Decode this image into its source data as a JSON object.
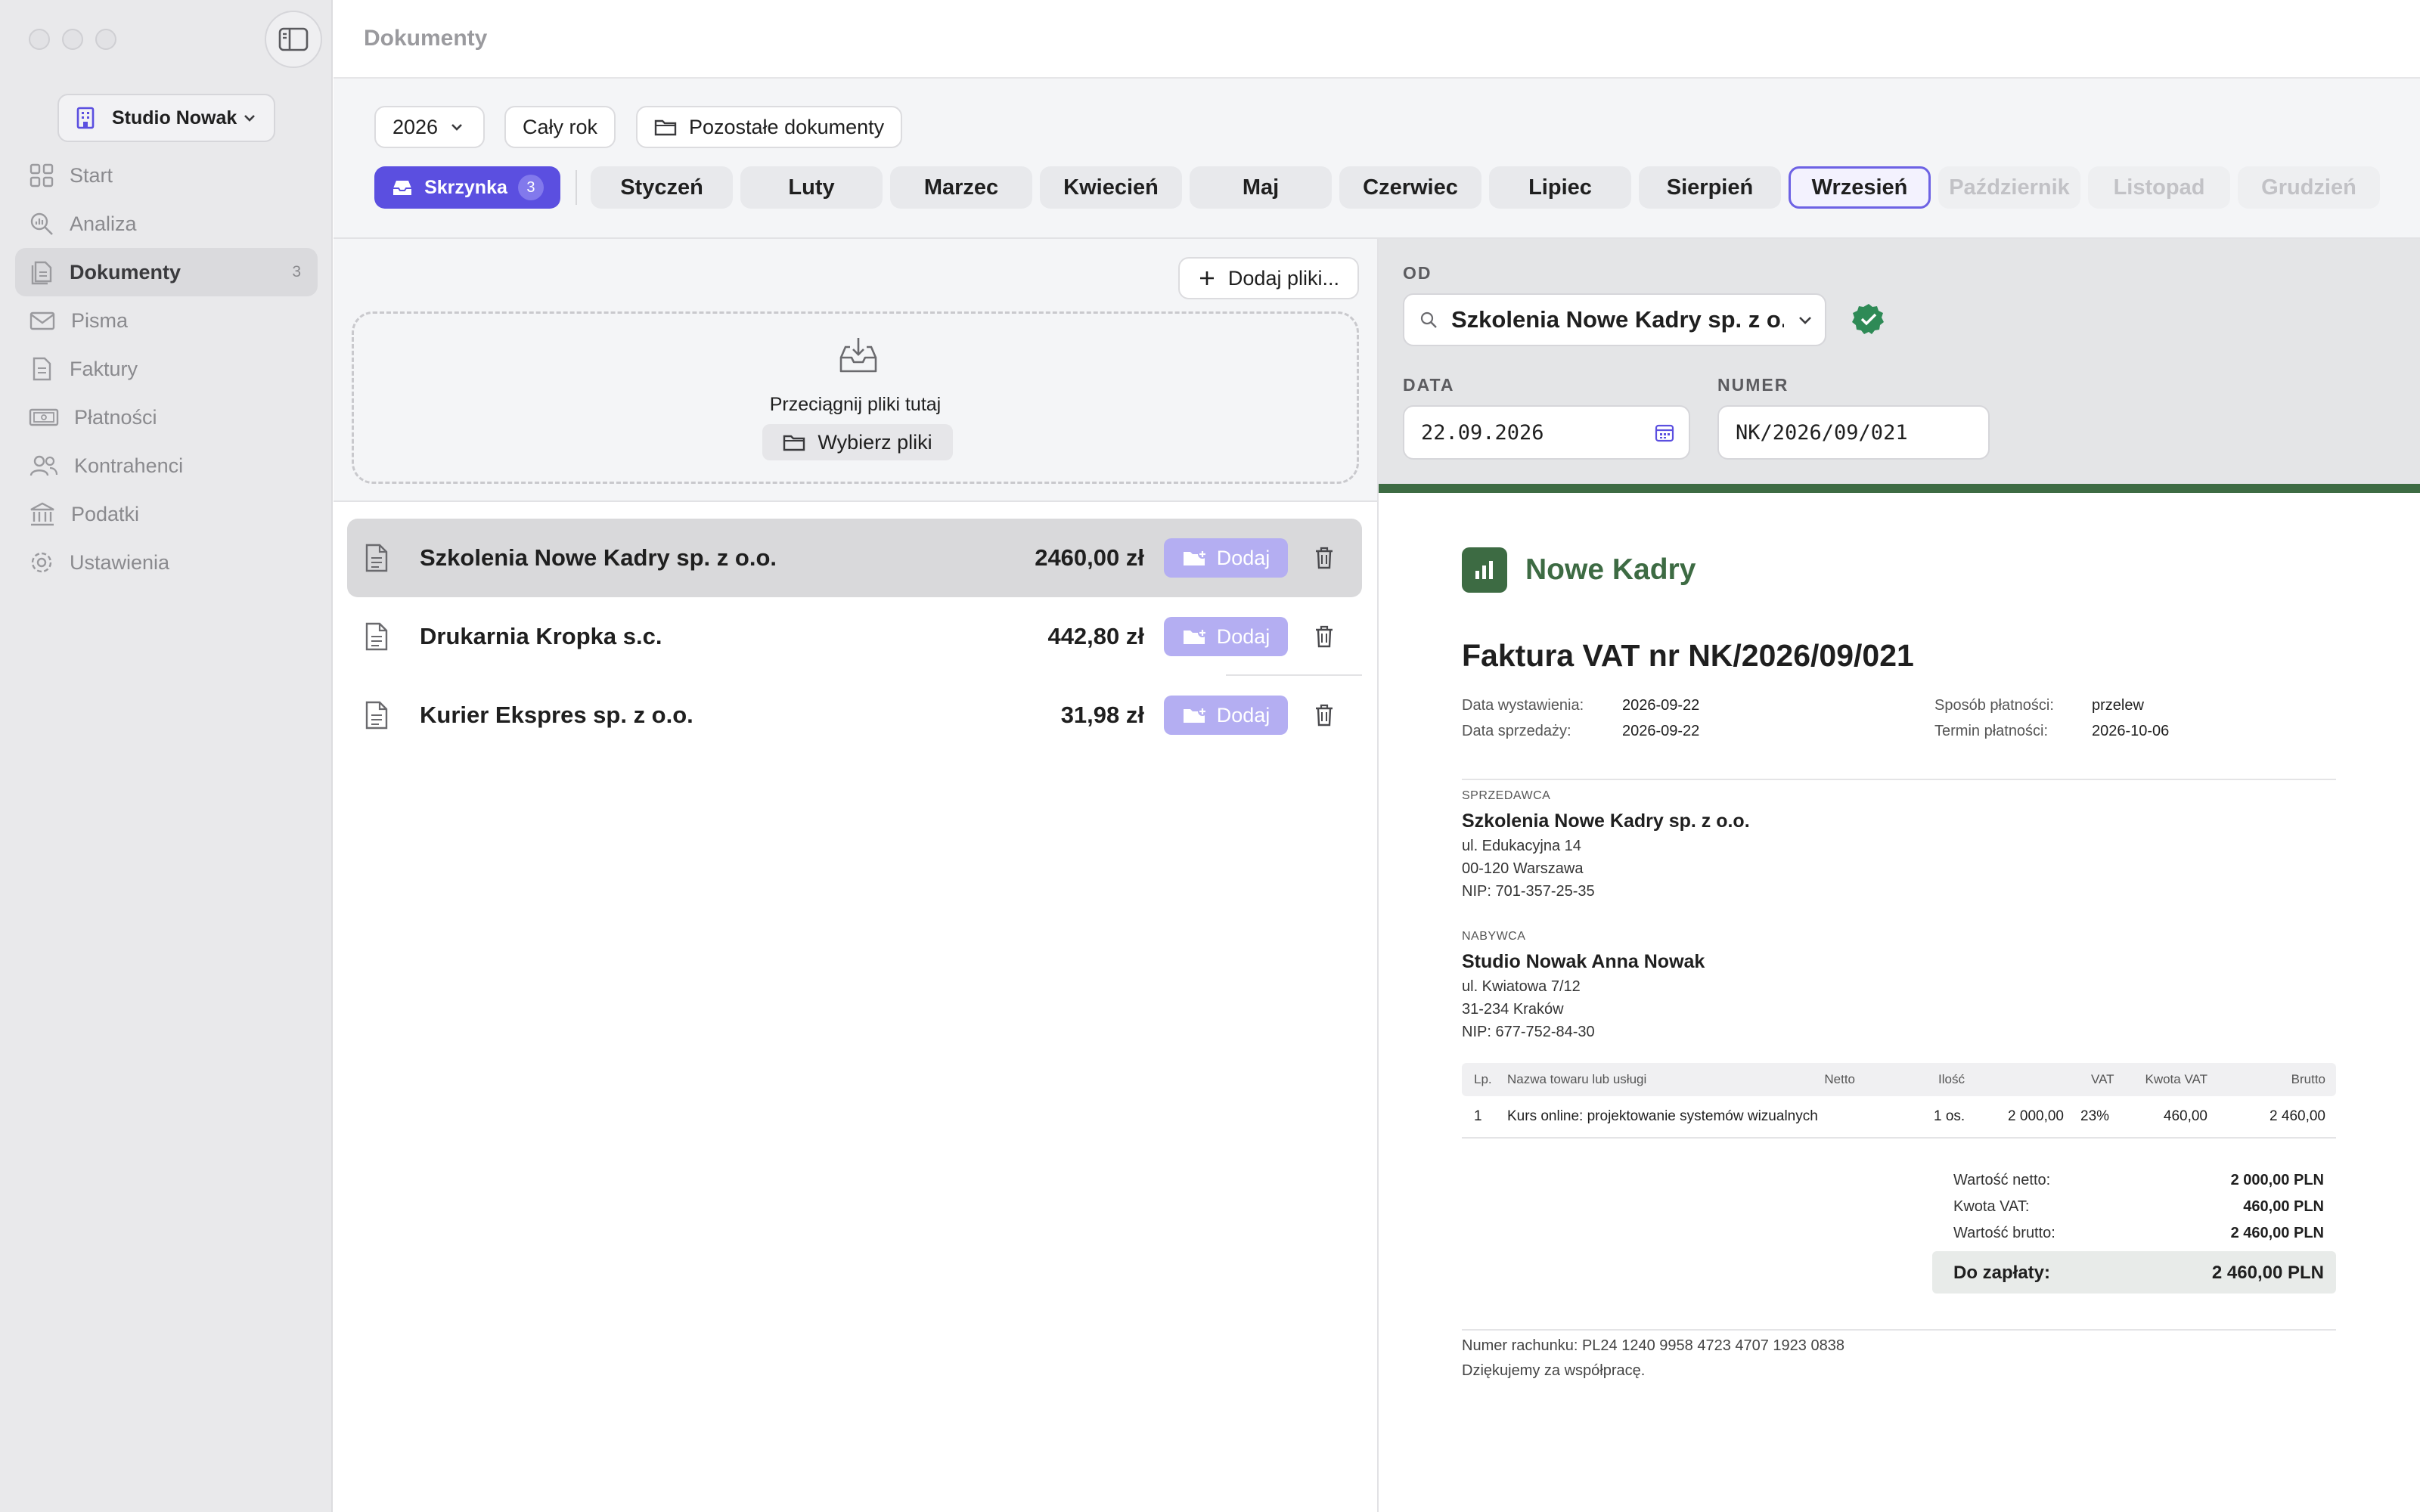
{
  "app": {
    "org_name": "Studio Nowak"
  },
  "sidebar": {
    "items": [
      {
        "label": "Start",
        "icon": "grid-icon"
      },
      {
        "label": "Analiza",
        "icon": "magnifier-chart-icon"
      },
      {
        "label": "Dokumenty",
        "icon": "documents-icon",
        "count": "3",
        "active": true
      },
      {
        "label": "Pisma",
        "icon": "envelope-icon"
      },
      {
        "label": "Faktury",
        "icon": "invoice-icon"
      },
      {
        "label": "Płatności",
        "icon": "banknote-icon"
      },
      {
        "label": "Kontrahenci",
        "icon": "people-icon"
      },
      {
        "label": "Podatki",
        "icon": "bank-icon"
      },
      {
        "label": "Ustawienia",
        "icon": "gear-icon"
      }
    ]
  },
  "header": {
    "title": "Dokumenty"
  },
  "toolbar": {
    "year": "2026",
    "whole_year": "Cały rok",
    "other_docs": "Pozostałe dokumenty",
    "inbox_label": "Skrzynka",
    "inbox_count": "3",
    "months": [
      "Styczeń",
      "Luty",
      "Marzec",
      "Kwiecień",
      "Maj",
      "Czerwiec",
      "Lipiec",
      "Sierpień",
      "Wrzesień",
      "Październik",
      "Listopad",
      "Grudzień"
    ],
    "selected_month": "Wrzesień",
    "disabled_months": [
      "Październik",
      "Listopad",
      "Grudzień"
    ]
  },
  "upload": {
    "add_files": "Dodaj pliki...",
    "drop_text": "Przeciągnij pliki tutaj",
    "choose_files": "Wybierz pliki"
  },
  "documents": [
    {
      "name": "Szkolenia Nowe Kadry sp. z o.o.",
      "amount": "2460,00 zł",
      "add_label": "Dodaj",
      "active": true
    },
    {
      "name": "Drukarnia Kropka s.c.",
      "amount": "442,80 zł",
      "add_label": "Dodaj"
    },
    {
      "name": "Kurier Ekspres sp. z o.o.",
      "amount": "31,98 zł",
      "add_label": "Dodaj"
    }
  ],
  "form": {
    "from_label": "OD",
    "vendor": "Szkolenia Nowe Kadry sp. z o.o.",
    "date_label": "DATA",
    "date_value": "22.09.2026",
    "number_label": "NUMER",
    "number_value": "NK/2026/09/021"
  },
  "invoice": {
    "brand": "Nowe Kadry",
    "title": "Faktura VAT nr NK/2026/09/021",
    "issue_date_label": "Data wystawienia:",
    "issue_date": "2026-09-22",
    "sale_date_label": "Data sprzedaży:",
    "sale_date": "2026-09-22",
    "payment_method_label": "Sposób płatności:",
    "payment_method": "przelew",
    "due_date_label": "Termin płatności:",
    "due_date": "2026-10-06",
    "seller": {
      "label": "SPRZEDAWCA",
      "name": "Szkolenia Nowe Kadry sp. z o.o.",
      "street": "ul. Edukacyjna 14",
      "city": "00-120 Warszawa",
      "nip": "NIP: 701-357-25-35"
    },
    "buyer": {
      "label": "NABYWCA",
      "name": "Studio Nowak Anna Nowak",
      "street": "ul. Kwiatowa 7/12",
      "city": "31-234 Kraków",
      "nip": "NIP: 677-752-84-30"
    },
    "columns": [
      "Lp.",
      "Nazwa towaru lub usługi",
      "Ilość",
      "Netto",
      "VAT",
      "Kwota VAT",
      "Brutto"
    ],
    "rows": [
      [
        "1",
        "Kurs online: projektowanie systemów wizualnych",
        "1 os.",
        "2 000,00",
        "23%",
        "460,00",
        "2 460,00"
      ]
    ],
    "net_label": "Wartość netto:",
    "net_value": "2 000,00 PLN",
    "vat_label": "Kwota VAT:",
    "vat_value": "460,00 PLN",
    "gross_label": "Wartość brutto:",
    "gross_value": "2 460,00 PLN",
    "due_label": "Do zapłaty:",
    "due_value": "2 460,00 PLN",
    "account": "Numer rachunku: PL24 1240 9958 4723 4707 1923 0838",
    "thanks": "Dziękujemy za współpracę."
  },
  "colors": {
    "accent": "#5b4fe0",
    "brand_green": "#3d6b43",
    "verified_green": "#2e8a56"
  }
}
